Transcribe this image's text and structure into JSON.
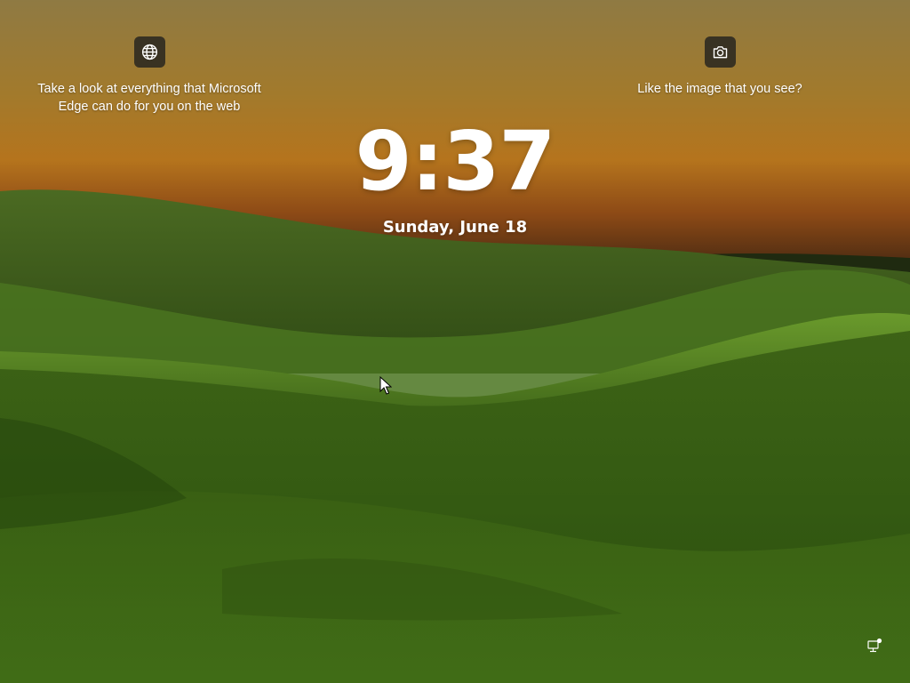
{
  "lock_screen": {
    "time": "9:37",
    "date": "Sunday, June 18"
  },
  "spotlight": {
    "left": {
      "icon": "globe-icon",
      "text": "Take a look at everything that Microsoft Edge can do for you on the web"
    },
    "right": {
      "icon": "camera-icon",
      "text": "Like the image that you see?"
    }
  },
  "status": {
    "network_icon": "ethernet-network-icon"
  },
  "colors": {
    "sky_top": "#8f7a43",
    "sky_horizon": "#c27a1c",
    "field_light": "#5c8c27",
    "field_dark": "#24420f",
    "icon_button_bg": "#1e1e1e"
  }
}
